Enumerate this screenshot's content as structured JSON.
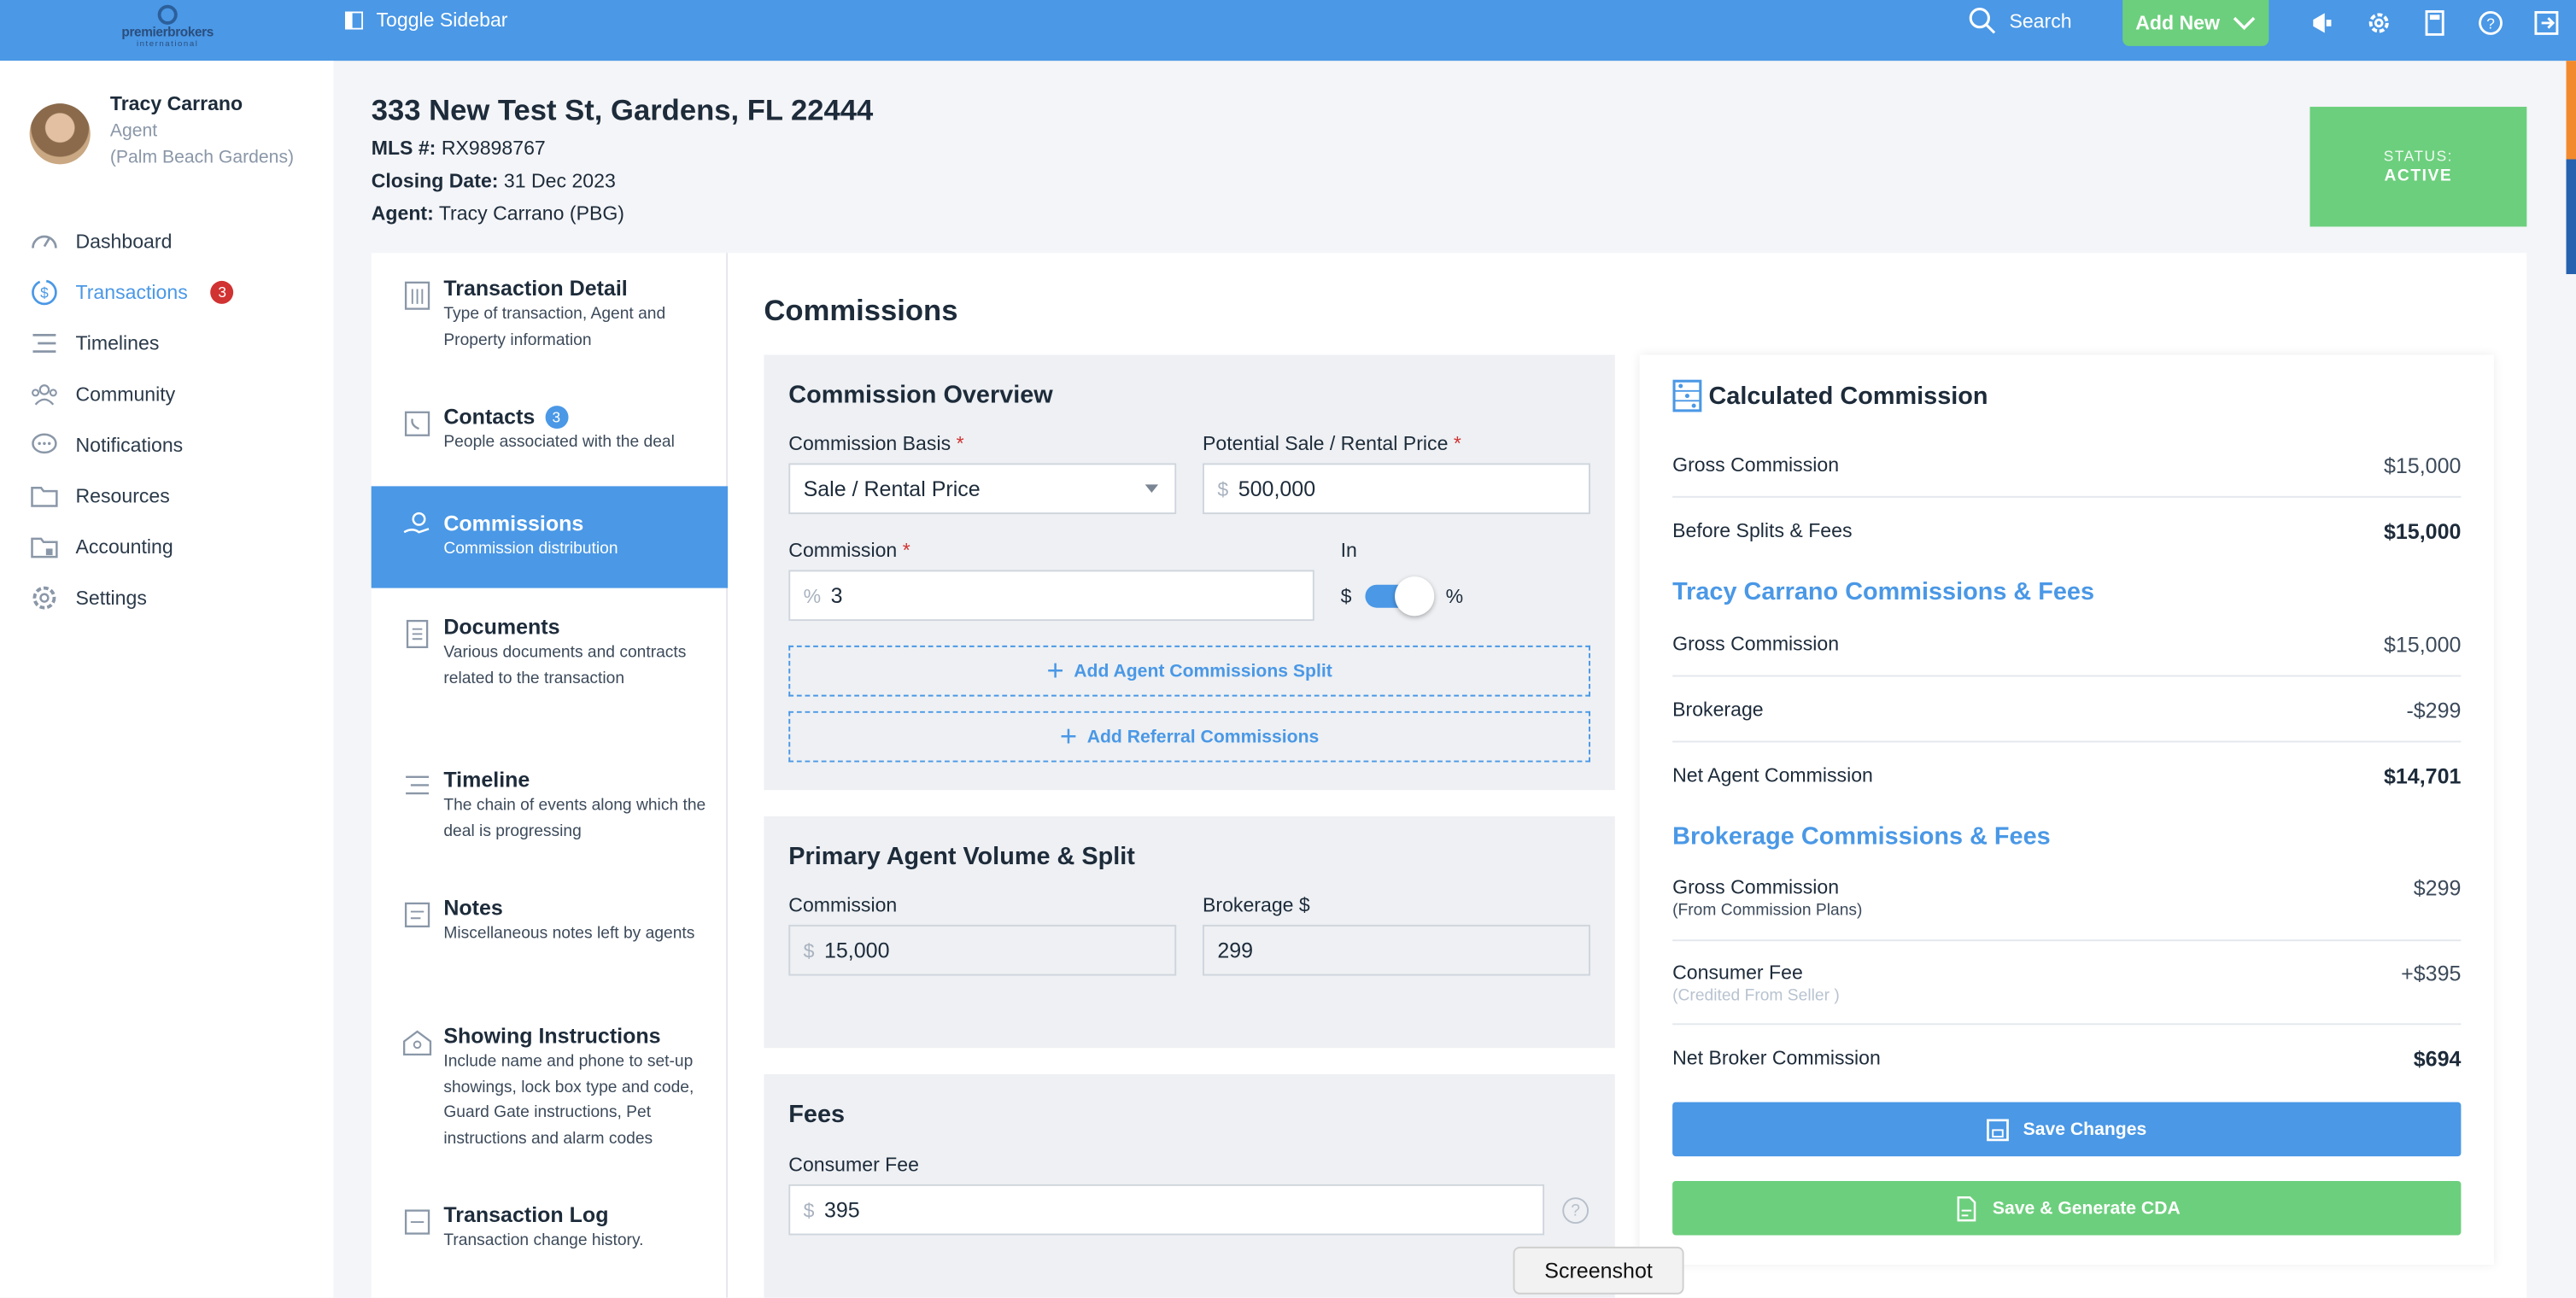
{
  "topbar": {
    "logo_brand": "premierbrokers",
    "logo_sub": "international",
    "toggle_label": "Toggle Sidebar",
    "search_label": "Search",
    "add_new_label": "Add New"
  },
  "user": {
    "name": "Tracy Carrano",
    "role": "Agent",
    "office": "(Palm Beach Gardens)"
  },
  "nav": {
    "items": [
      {
        "label": "Dashboard",
        "icon": "gauge-icon"
      },
      {
        "label": "Transactions",
        "icon": "dollar-cycle-icon",
        "badge": "3"
      },
      {
        "label": "Timelines",
        "icon": "timeline-icon"
      },
      {
        "label": "Community",
        "icon": "people-icon"
      },
      {
        "label": "Notifications",
        "icon": "chat-icon"
      },
      {
        "label": "Resources",
        "icon": "folder-icon"
      },
      {
        "label": "Accounting",
        "icon": "lock-folder-icon"
      },
      {
        "label": "Settings",
        "icon": "gear-icon"
      }
    ]
  },
  "header": {
    "address": "333 New Test St, Gardens, FL 22444",
    "mls_label": "MLS #:",
    "mls_value": "RX9898767",
    "closing_label": "Closing Date:",
    "closing_value": "31 Dec 2023",
    "agent_label": "Agent:",
    "agent_value": "Tracy Carrano (PBG)",
    "status_label": "STATUS:",
    "status_value": "ACTIVE"
  },
  "sections": [
    {
      "title": "Transaction Detail",
      "desc": "Type of transaction, Agent and Property information"
    },
    {
      "title": "Contacts",
      "badge": "3",
      "desc": "People associated with the deal"
    },
    {
      "title": "Commissions",
      "desc": "Commission distribution"
    },
    {
      "title": "Documents",
      "desc": "Various documents and contracts related to the transaction"
    },
    {
      "title": "Timeline",
      "desc": "The chain of events along which the deal is progressing"
    },
    {
      "title": "Notes",
      "desc": "Miscellaneous notes left by agents"
    },
    {
      "title": "Showing Instructions",
      "desc": "Include name and phone to set-up showings, lock box type and code, Guard Gate instructions, Pet instructions and alarm codes"
    },
    {
      "title": "Transaction Log",
      "desc": "Transaction change history."
    }
  ],
  "commissions": {
    "page_title": "Commissions",
    "overview": {
      "title": "Commission Overview",
      "basis_label": "Commission Basis",
      "basis_value": "Sale / Rental Price",
      "price_label": "Potential Sale / Rental Price",
      "price_prefix": "$",
      "price_value": "500,000",
      "commission_label": "Commission",
      "commission_prefix": "%",
      "commission_value": "3",
      "in_label": "In",
      "toggle_left": "$",
      "toggle_right": "%",
      "add_split": "Add Agent Commissions Split",
      "add_referral": "Add Referral Commissions",
      "required_mark": "*"
    },
    "primary": {
      "title": "Primary Agent Volume & Split",
      "commission_label": "Commission",
      "commission_prefix": "$",
      "commission_value": "15,000",
      "brokerage_label": "Brokerage $",
      "brokerage_value": "299"
    },
    "fees": {
      "title": "Fees",
      "consumer_label": "Consumer Fee",
      "consumer_prefix": "$",
      "consumer_value": "395",
      "help": "?"
    }
  },
  "calc": {
    "title": "Calculated Commission",
    "gross_label": "Gross Commission",
    "gross_value": "$15,000",
    "before_label": "Before Splits & Fees",
    "before_value": "$15,000",
    "agent_section": "Tracy Carrano Commissions & Fees",
    "agent_gross_label": "Gross Commission",
    "agent_gross_value": "$15,000",
    "brokerage_label": "Brokerage",
    "brokerage_value": "-$299",
    "net_agent_label": "Net Agent Commission",
    "net_agent_value": "$14,701",
    "broker_section": "Brokerage Commissions & Fees",
    "broker_gross_label": "Gross Commission",
    "broker_gross_sub": "(From Commission Plans)",
    "broker_gross_value": "$299",
    "consumer_label": "Consumer Fee",
    "consumer_sub": "(Credited From Seller )",
    "consumer_value": "+$395",
    "net_broker_label": "Net Broker Commission",
    "net_broker_value": "$694",
    "save_label": "Save Changes",
    "save_cda_label": "Save & Generate CDA"
  },
  "tooltip": "Screenshot",
  "colors": {
    "accent": "#4a98e6",
    "success": "#6ccf7d",
    "danger": "#d13232"
  }
}
